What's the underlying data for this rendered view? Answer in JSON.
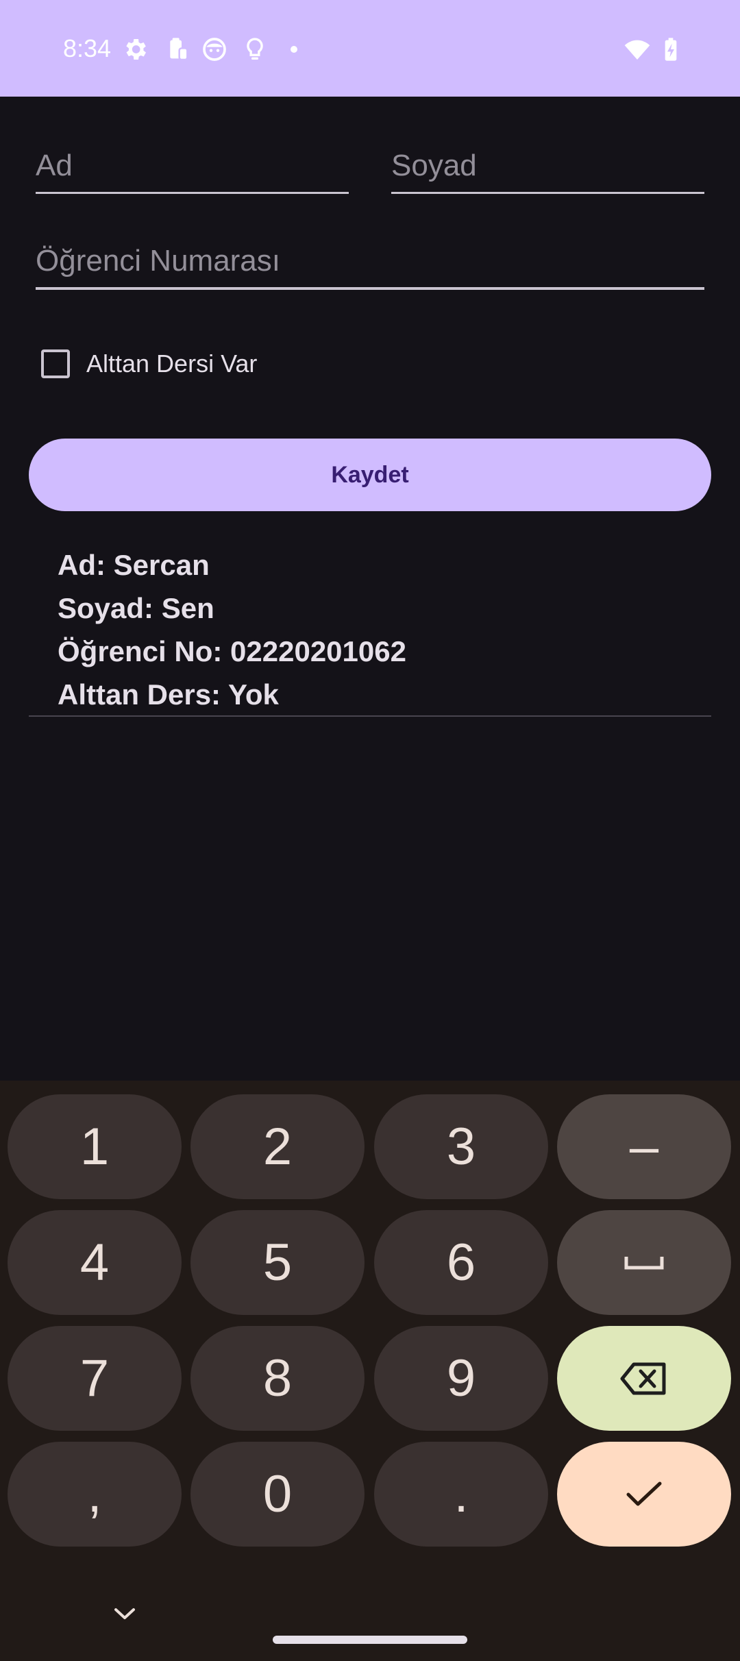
{
  "status_bar": {
    "time": "8:34"
  },
  "form": {
    "first_name_placeholder": "Ad",
    "last_name_placeholder": "Soyad",
    "student_number_placeholder": "Öğrenci Numarası",
    "checkbox_label": "Alttan Dersi Var",
    "checkbox_checked": false,
    "save_label": "Kaydet"
  },
  "result": {
    "first_name": "Ad: Sercan",
    "last_name": "Soyad: Sen",
    "student_number": "Öğrenci No: 02220201062",
    "failed_course": "Alttan Ders: Yok"
  },
  "keyboard": {
    "keys": [
      "1",
      "2",
      "3",
      "–",
      "4",
      "5",
      "6",
      "␣",
      "7",
      "8",
      "9",
      "⌫",
      ",",
      "0",
      ".",
      "✓"
    ]
  },
  "colors": {
    "accent": "#D0BCFF",
    "background": "#141218",
    "keyboard_bg": "#211A17",
    "delete_key": "#DFE8BA",
    "done_key": "#FFDBC2"
  }
}
